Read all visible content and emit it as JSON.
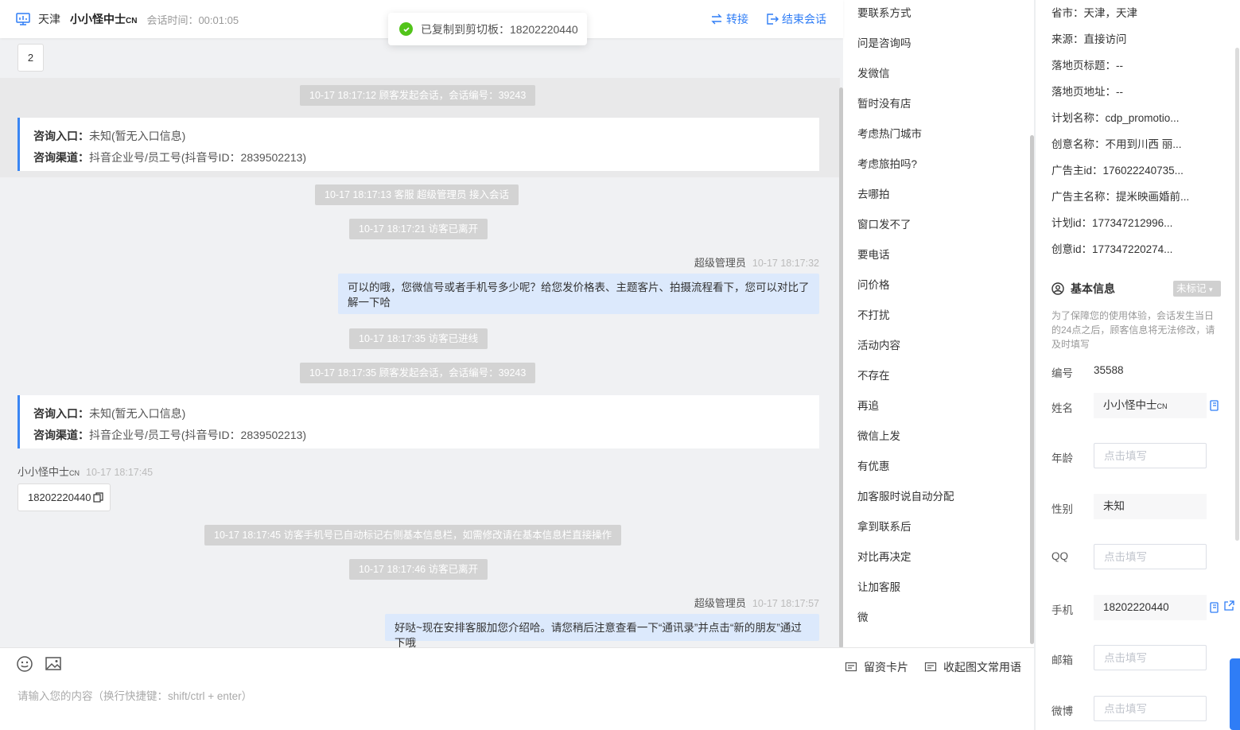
{
  "header": {
    "city": "天津",
    "visitor_name": "小小怪中士",
    "visitor_suffix": "CN",
    "session_time": "会话时间：00:01:05",
    "transfer_label": "转接",
    "end_label": "结束会话"
  },
  "toast": {
    "text": "已复制到剪切板：18202220440"
  },
  "top_chip": "2",
  "messages": {
    "sys1": "10-17 18:17:12 顾客发起会话，会话编号：39243",
    "card1": {
      "entry_label": "咨询入口：",
      "entry_value": "未知(暂无入口信息)",
      "channel_label": "咨询渠道：",
      "channel_value": "抖音企业号/员工号(抖音号ID：2839502213)"
    },
    "sys2": "10-17 18:17:13 客服 超级管理员 接入会话",
    "sys3": "10-17 18:17:21 访客已离开",
    "agent1": {
      "name": "超级管理员",
      "time": "10-17 18:17:32",
      "text": "可以的哦，您微信号或者手机号多少呢？给您发价格表、主题客片、拍摄流程看下，您可以对比了解一下哈"
    },
    "sys4": "10-17 18:17:35 访客已进线",
    "sys5": "10-17 18:17:35 顾客发起会话，会话编号：39243",
    "card2": {
      "entry_label": "咨询入口：",
      "entry_value": "未知(暂无入口信息)",
      "channel_label": "咨询渠道：",
      "channel_value": "抖音企业号/员工号(抖音号ID：2839502213)"
    },
    "visitor1": {
      "name": "小小怪中士",
      "suffix": "CN",
      "time": "10-17 18:17:45",
      "text": "18202220440"
    },
    "sys6": "10-17 18:17:45 访客手机号已自动标记右侧基本信息栏，如需修改请在基本信息栏直接操作",
    "sys7": "10-17 18:17:46 访客已离开",
    "agent2": {
      "name": "超级管理员",
      "time": "10-17 18:17:57",
      "text": "好哒~现在安排客服加您介绍哈。请您稍后注意查看一下“通讯录”并点击“新的朋友”通过下哦"
    }
  },
  "input": {
    "placeholder": "请输入您的内容（换行快捷键：shift/ctrl + enter）",
    "card_label": "留资卡片",
    "collapse_label": "收起图文常用语"
  },
  "phrases": [
    "要联系方式",
    "问是咨询吗",
    "发微信",
    "暂时没有店",
    "考虑热门城市",
    "考虑旅拍吗?",
    "去哪拍",
    "窗口发不了",
    "要电话",
    "问价格",
    "不打扰",
    "活动内容",
    "不存在",
    "再追",
    "微信上发",
    "有优惠",
    "加客服时说自动分配",
    "拿到联系后",
    "对比再决定",
    "让加客服",
    "微"
  ],
  "source_info": [
    "省市：天津，天津",
    "来源：直接访问",
    "落地页标题：--",
    "落地页地址：--",
    "计划名称：cdp_promotio...",
    "创意名称：不用到川西 丽...",
    "广告主id：176022240735...",
    "广告主名称：提米映画婚前...",
    "计划id：177347212996...",
    "创意id：177347220274..."
  ],
  "basic_info": {
    "title": "基本信息",
    "tag": "未标记",
    "notice": "为了保障您的使用体验，会话发生当日的24点之后，顾客信息将无法修改，请及时填写",
    "id_label": "编号",
    "id_value": "35588",
    "name_label": "姓名",
    "name_value": "小小怪中士",
    "name_suffix": "CN",
    "age_label": "年龄",
    "age_placeholder": "点击填写",
    "gender_label": "性别",
    "gender_value": "未知",
    "qq_label": "QQ",
    "qq_placeholder": "点击填写",
    "phone_label": "手机",
    "phone_value": "18202220440",
    "email_label": "邮箱",
    "email_placeholder": "点击填写",
    "weibo_label": "微博",
    "weibo_placeholder": "点击填写"
  },
  "colors": {
    "accent": "#2f7df6",
    "success": "#52c41a",
    "agent_bubble": "#dce9fc",
    "system_pill": "#d3d3d3"
  }
}
